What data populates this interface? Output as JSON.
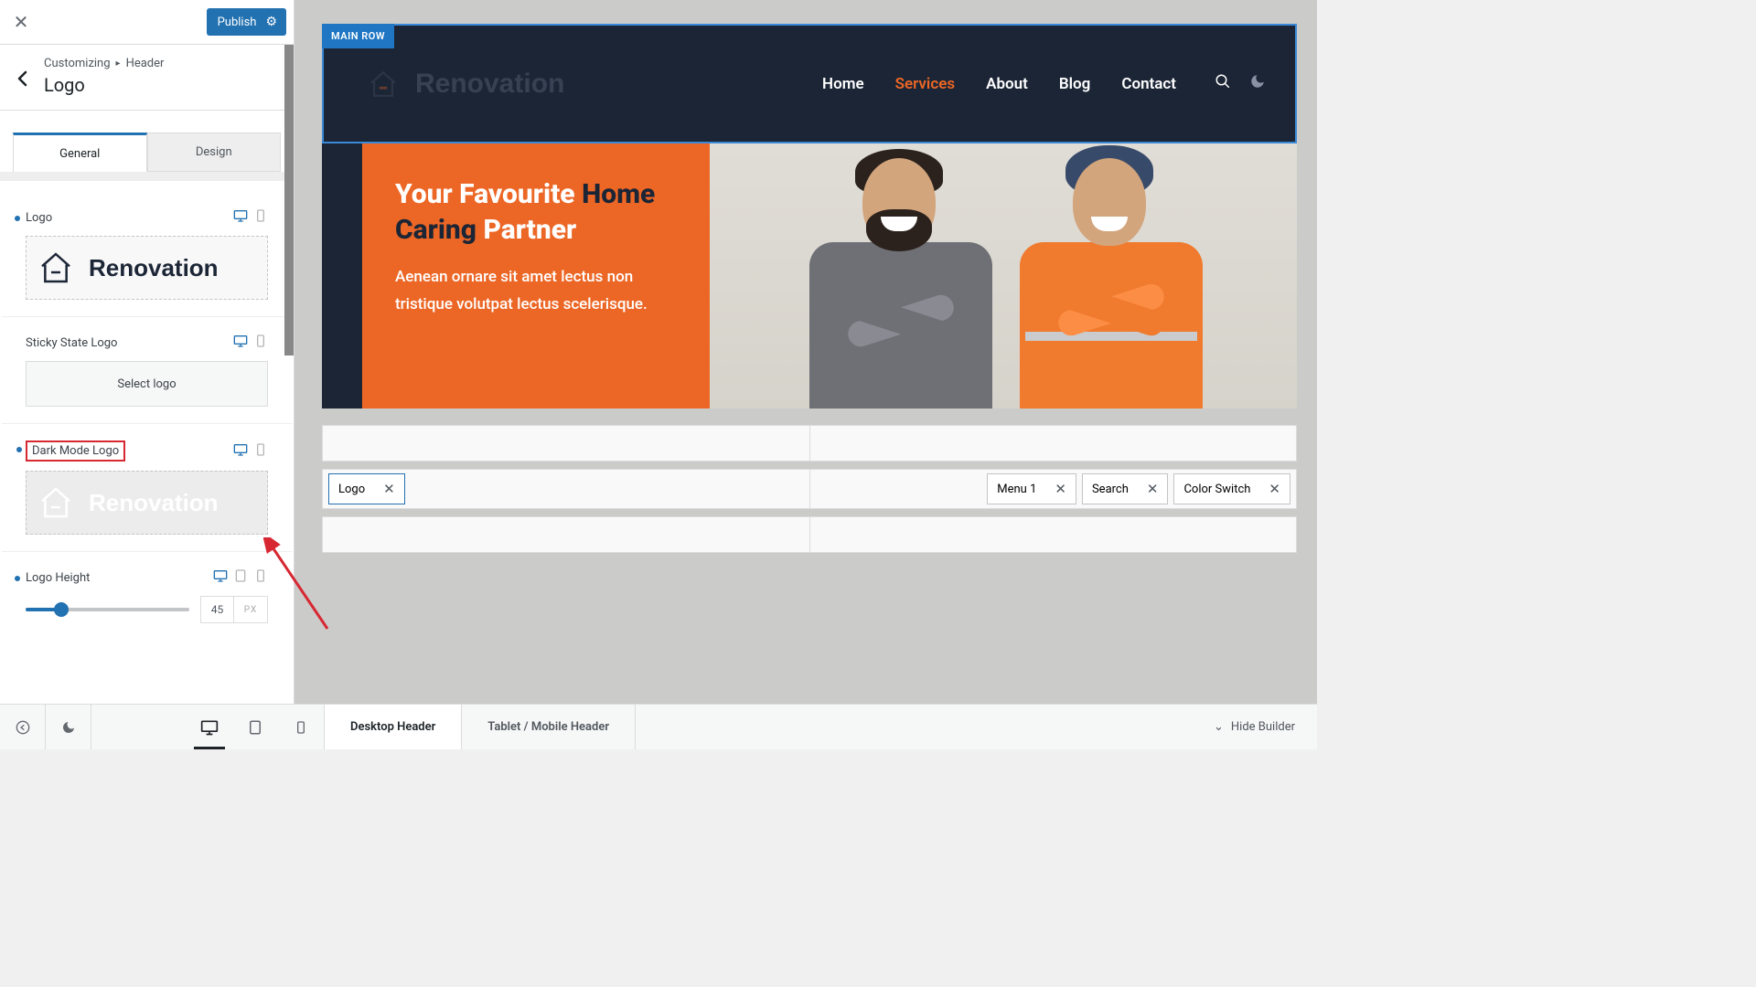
{
  "header": {
    "publish": "Publish",
    "breadcrumb_root": "Customizing",
    "breadcrumb_parent": "Header",
    "panel_title": "Logo"
  },
  "tabs": {
    "general": "General",
    "design": "Design"
  },
  "fields": {
    "logo_label": "Logo",
    "logo_brand": "Renovation",
    "sticky_label": "Sticky State Logo",
    "select_logo": "Select logo",
    "dark_label": "Dark Mode Logo",
    "dark_brand": "Renovation",
    "height_label": "Logo Height",
    "height_value": "45",
    "height_unit": "PX"
  },
  "preview": {
    "badge": "MAIN ROW",
    "brand": "Renovation",
    "nav": {
      "home": "Home",
      "services": "Services",
      "about": "About",
      "blog": "Blog",
      "contact": "Contact"
    },
    "hero_title_1": "Your Favourite ",
    "hero_title_2a": "Home",
    "hero_title_2b": "Caring",
    "hero_title_3": " Partner",
    "hero_body": "Aenean ornare sit amet lectus non tristique volutpat lectus scelerisque."
  },
  "builder": {
    "logo": "Logo",
    "menu": "Menu 1",
    "search": "Search",
    "color_switch": "Color Switch"
  },
  "footer": {
    "tab_desktop": "Desktop Header",
    "tab_mobile": "Tablet / Mobile Header",
    "hide": "Hide Builder"
  }
}
